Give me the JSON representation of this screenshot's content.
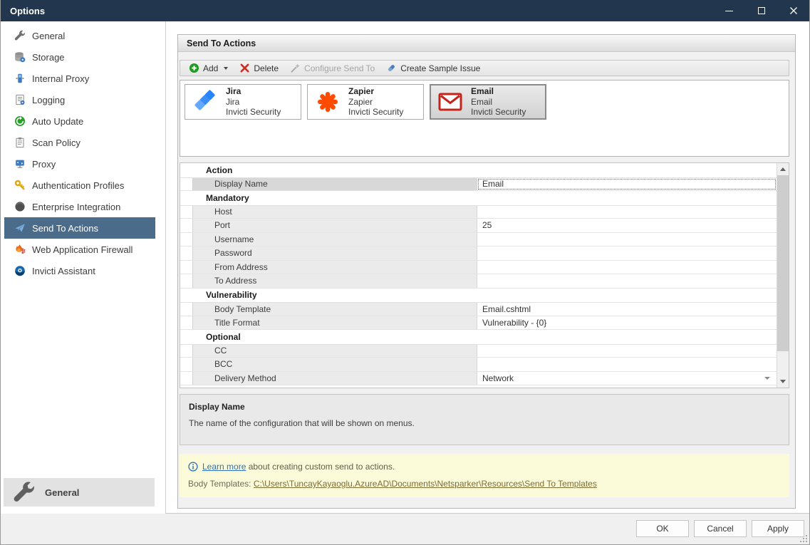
{
  "window": {
    "title": "Options"
  },
  "sidebar": {
    "items": [
      {
        "label": "General",
        "icon": "wrench-icon",
        "selected": false
      },
      {
        "label": "Storage",
        "icon": "storage-icon",
        "selected": false
      },
      {
        "label": "Internal Proxy",
        "icon": "internal-proxy-icon",
        "selected": false
      },
      {
        "label": "Logging",
        "icon": "logging-icon",
        "selected": false
      },
      {
        "label": "Auto Update",
        "icon": "auto-update-icon",
        "selected": false
      },
      {
        "label": "Scan Policy",
        "icon": "scan-policy-icon",
        "selected": false
      },
      {
        "label": "Proxy",
        "icon": "proxy-icon",
        "selected": false
      },
      {
        "label": "Authentication Profiles",
        "icon": "key-icon",
        "selected": false
      },
      {
        "label": "Enterprise Integration",
        "icon": "enterprise-icon",
        "selected": false
      },
      {
        "label": "Send To Actions",
        "icon": "send-to-icon",
        "selected": true
      },
      {
        "label": "Web Application Firewall",
        "icon": "firewall-icon",
        "selected": false
      },
      {
        "label": "Invicti Assistant",
        "icon": "assistant-icon",
        "selected": false
      }
    ],
    "footer": {
      "label": "General",
      "icon": "wrench-icon"
    }
  },
  "panel": {
    "title": "Send To Actions"
  },
  "toolbar": {
    "items": [
      {
        "label": "Add",
        "icon": "add-icon",
        "dropdown": true,
        "disabled": false
      },
      {
        "label": "Delete",
        "icon": "delete-icon",
        "dropdown": false,
        "disabled": false
      },
      {
        "label": "Configure Send To",
        "icon": "configure-icon",
        "dropdown": false,
        "disabled": true
      },
      {
        "label": "Create Sample Issue",
        "icon": "sample-issue-icon",
        "dropdown": false,
        "disabled": false
      }
    ]
  },
  "actions": {
    "cards": [
      {
        "name": "Jira",
        "type": "Jira",
        "vendor": "Invicti Security",
        "icon": "jira-icon",
        "selected": false
      },
      {
        "name": "Zapier",
        "type": "Zapier",
        "vendor": "Invicti Security",
        "icon": "zapier-icon",
        "selected": false
      },
      {
        "name": "Email",
        "type": "Email",
        "vendor": "Invicti Security",
        "icon": "email-icon",
        "selected": true
      }
    ]
  },
  "property_grid": {
    "rows": [
      {
        "type": "category",
        "label": "Action"
      },
      {
        "type": "property",
        "label": "Display Name",
        "value": "Email",
        "selected": true,
        "dropdown": false
      },
      {
        "type": "category",
        "label": "Mandatory"
      },
      {
        "type": "property",
        "label": "Host",
        "value": "",
        "selected": false,
        "dropdown": false
      },
      {
        "type": "property",
        "label": "Port",
        "value": "25",
        "selected": false,
        "dropdown": false
      },
      {
        "type": "property",
        "label": "Username",
        "value": "",
        "selected": false,
        "dropdown": false
      },
      {
        "type": "property",
        "label": "Password",
        "value": "",
        "selected": false,
        "dropdown": false
      },
      {
        "type": "property",
        "label": "From Address",
        "value": "",
        "selected": false,
        "dropdown": false
      },
      {
        "type": "property",
        "label": "To Address",
        "value": "",
        "selected": false,
        "dropdown": false
      },
      {
        "type": "category",
        "label": "Vulnerability"
      },
      {
        "type": "property",
        "label": "Body Template",
        "value": "Email.cshtml",
        "selected": false,
        "dropdown": false
      },
      {
        "type": "property",
        "label": "Title Format",
        "value": "Vulnerability - {0}",
        "selected": false,
        "dropdown": false
      },
      {
        "type": "category",
        "label": "Optional"
      },
      {
        "type": "property",
        "label": "CC",
        "value": "",
        "selected": false,
        "dropdown": false
      },
      {
        "type": "property",
        "label": "BCC",
        "value": "",
        "selected": false,
        "dropdown": false
      },
      {
        "type": "property",
        "label": "Delivery Method",
        "value": "Network",
        "selected": false,
        "dropdown": true
      }
    ]
  },
  "description": {
    "title": "Display Name",
    "text": "The name of the configuration that will be shown on menus."
  },
  "info_bar": {
    "info_icon": "info-icon",
    "learn_more": "Learn more",
    "learn_more_rest": " about creating custom send to actions.",
    "body_templates_label": "Body Templates: ",
    "body_templates_path": "C:\\Users\\TuncayKayaoglu.AzureAD\\Documents\\Netsparker\\Resources\\Send To Templates"
  },
  "footer": {
    "buttons": [
      "OK",
      "Cancel",
      "Apply"
    ]
  },
  "colors": {
    "titlebar": "#22374e",
    "sidebar_selected": "#4b6b8b",
    "jira_blue": "#2684ff",
    "zapier_orange": "#ff4a00",
    "email_red": "#c4241a",
    "info_bar_bg": "#fbfbda",
    "link_blue": "#2d73b5",
    "path_link": "#7d6b33"
  }
}
